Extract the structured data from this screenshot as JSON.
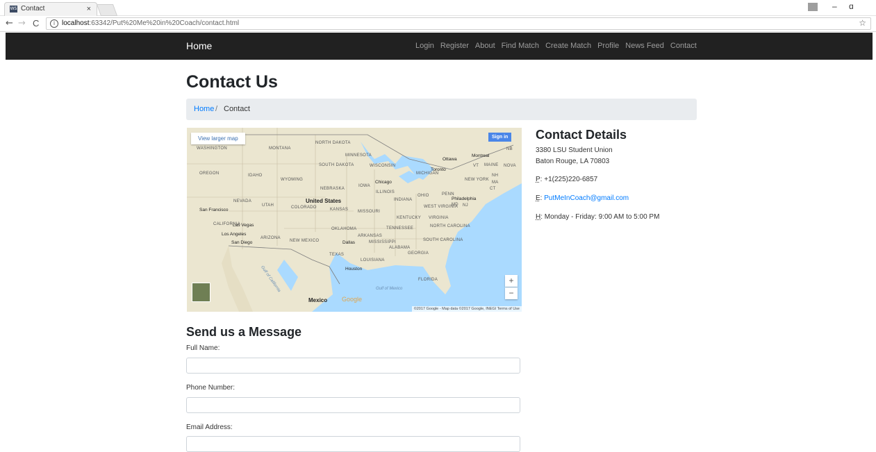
{
  "browser": {
    "tab_title": "Contact",
    "tab_close": "×",
    "url_host": "localhost",
    "url_rest": ":63342/Put%20Me%20in%20Coach/contact.html",
    "back": "←",
    "forward": "→",
    "reload": "C",
    "info": "i",
    "star": "☆",
    "minimize": "–",
    "restore": "ɑ",
    "favicon_text": "WS"
  },
  "navbar": {
    "brand": "Home",
    "links": [
      "Login",
      "Register",
      "About",
      "Find Match",
      "Create Match",
      "Profile",
      "News Feed",
      "Contact"
    ]
  },
  "page": {
    "title": "Contact Us",
    "breadcrumb": {
      "home": "Home",
      "separator": "/",
      "current": "Contact"
    }
  },
  "map": {
    "view_larger": "View larger map",
    "sign_in": "Sign in",
    "zoom_in": "+",
    "zoom_out": "−",
    "google": "Google",
    "attribution": "©2017 Google - Map data ©2017 Google, INEGI   Terms of Use",
    "country_labels": [
      "United States",
      "Mexico"
    ],
    "state_labels": [
      "NORTH DAKOTA",
      "MONTANA",
      "WASHINGTON",
      "MINNESOTA",
      "SOUTH DAKOTA",
      "OREGON",
      "IDAHO",
      "WYOMING",
      "WISCONSIN",
      "MICHIGAN",
      "NEBRASKA",
      "IOWA",
      "NEVADA",
      "UTAH",
      "COLORADO",
      "KANSAS",
      "MISSOURI",
      "ILLINOIS",
      "INDIANA",
      "OHIO",
      "PENN",
      "CALIFORNIA",
      "ARIZONA",
      "NEW MEXICO",
      "OKLAHOMA",
      "ARKANSAS",
      "TENNESSEE",
      "KENTUCKY",
      "VIRGINIA",
      "WEST VIRGINIA",
      "NORTH CAROLINA",
      "SOUTH CAROLINA",
      "MISSISSIPPI",
      "ALABAMA",
      "GEORGIA",
      "TEXAS",
      "LOUISIANA",
      "FLORIDA",
      "NEW YORK",
      "MAINE",
      "NOVA",
      "VT",
      "NH",
      "MA",
      "CT",
      "MD",
      "NJ",
      "NB"
    ],
    "city_labels": [
      "Ottawa",
      "Montreal",
      "Toronto",
      "Chicago",
      "Philadelphia",
      "San Francisco",
      "Las Vegas",
      "Los Angeles",
      "San Diego",
      "Dallas",
      "Houston"
    ],
    "water_labels": [
      "Gulf of Mexico",
      "Gulf of California"
    ]
  },
  "contact": {
    "title": "Contact Details",
    "address_line1": "3380 LSU Student Union",
    "address_line2": "Baton Rouge, LA 70803",
    "phone_abbr": "P",
    "phone": "+1(225)220-6857",
    "email_abbr": "E",
    "email": "PutMeInCoach@gmail.com",
    "hours_abbr": "H",
    "hours": "Monday - Friday: 9:00 AM to 5:00 PM"
  },
  "form": {
    "title": "Send us a Message",
    "full_name_label": "Full Name:",
    "phone_label": "Phone Number:",
    "email_label": "Email Address:",
    "full_name_value": "",
    "phone_value": "",
    "email_value": ""
  },
  "colors": {
    "navbar_bg": "#212121",
    "link": "#007bff",
    "breadcrumb_bg": "#e9ecef",
    "water": "#aadaff",
    "land": "#ebe6d0"
  }
}
